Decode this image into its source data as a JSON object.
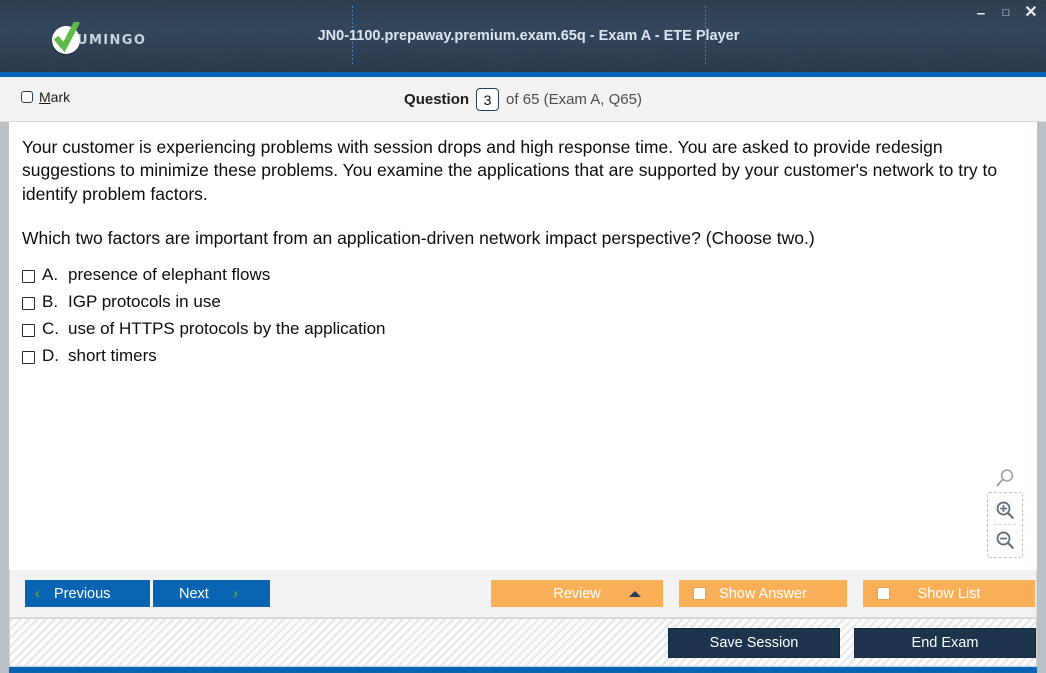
{
  "window": {
    "title": "JN0-1100.prepaway.premium.exam.65q - Exam A - ETE Player",
    "logo_text": "UMINGO",
    "controls": {
      "minimize": "–",
      "maximize": "□",
      "close": "✕"
    }
  },
  "question_header": {
    "mark_label_prefix": "M",
    "mark_label_rest": "ark",
    "question_label": "Question",
    "question_number": "3",
    "of_text": "of 65 (Exam A, Q65)"
  },
  "question": {
    "paragraph1": "Your customer is experiencing problems with session drops and high response time. You are asked to provide redesign suggestions to minimize these problems. You examine the applications that are supported by your customer's network to try to identify problem factors.",
    "paragraph2": "Which two factors are important from an application-driven network impact perspective? (Choose two.)",
    "choices": [
      {
        "letter": "A.",
        "text": "presence of elephant flows",
        "checked": false
      },
      {
        "letter": "B.",
        "text": "IGP protocols in use",
        "checked": false
      },
      {
        "letter": "C.",
        "text": "use of HTTPS protocols by the application",
        "checked": false
      },
      {
        "letter": "D.",
        "text": "short timers",
        "checked": false
      }
    ]
  },
  "zoom_widget": {
    "search_icon": "magnifier-icon",
    "zoom_in_icon": "zoom-in-icon",
    "zoom_out_icon": "zoom-out-icon"
  },
  "toolbar": {
    "previous_label": "Previous",
    "next_label": "Next",
    "review_label": "Review",
    "show_answer_label": "Show Answer",
    "show_list_label": "Show List",
    "prev_chevron": "‹",
    "next_chevron": "›"
  },
  "bottom_bar": {
    "save_session_label": "Save Session",
    "end_exam_label": "End Exam"
  },
  "colors": {
    "titlebar": "#2d3e52",
    "accent_blue": "#0a64b4",
    "orange": "#f9af58",
    "dark_button": "#1d344d",
    "chevron_green": "#5aa032",
    "logo_green": "#5fba47",
    "frame_gray": "#b9c0c6"
  }
}
